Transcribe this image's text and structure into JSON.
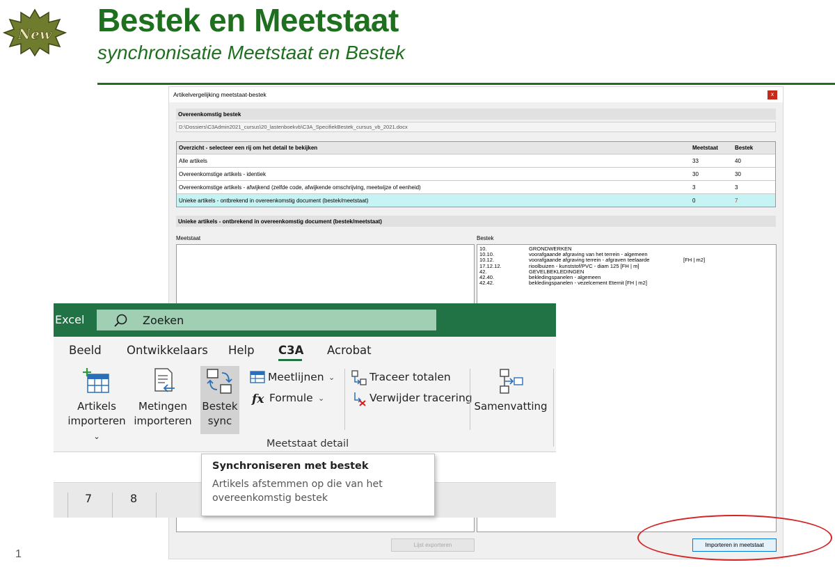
{
  "slide": {
    "title": "Bestek en Meetstaat",
    "subtitle": "synchronisatie Meetstaat en Bestek",
    "badge": "New",
    "page_number": "1"
  },
  "dialog": {
    "title": "Artikelvergelijking meetstaat-bestek",
    "close": "x",
    "section_bestek": "Overeenkomstig bestek",
    "path": "D:\\Dossiers\\C3Admin2021_cursus\\20_lastenboekvb\\C3A_SpecifiekBestek_cursus_vb_2021.docx",
    "overview": {
      "headers": [
        "Overzicht - selecteer een rij om het detail te bekijken",
        "Meetstaat",
        "Bestek"
      ],
      "rows": [
        {
          "label": "Alle artikels",
          "meetstaat": "33",
          "bestek": "40"
        },
        {
          "label": "Overeenkomstige artikels - identiek",
          "meetstaat": "30",
          "bestek": "30"
        },
        {
          "label": "Overeenkomstige artikels - afwijkend (zelfde code, afwijkende omschrijving, meetwijze of eenheid)",
          "meetstaat": "3",
          "bestek": "3"
        },
        {
          "label": "Unieke artikels - ontbrekend in overeenkomstig document (bestek/meetstaat)",
          "meetstaat": "0",
          "bestek": "7"
        }
      ],
      "selected_index": 3
    },
    "detail_section": "Unieke artikels - ontbrekend in overeenkomstig document (bestek/meetstaat)",
    "meetstaat_label": "Meetstaat",
    "bestek_label": "Bestek",
    "bestek_items": [
      {
        "code": "10.",
        "desc": "GRONDWERKEN",
        "unit": ""
      },
      {
        "code": "10.10.",
        "desc": "voorafgaande afgraving van het terrein - algemeen",
        "unit": ""
      },
      {
        "code": "10.12.",
        "desc": "voorafgaande afgraving terrein - afgraven teelaarde",
        "unit": "[FH | m2]"
      },
      {
        "code": "17.12.12.",
        "desc": "rioolbuizen - kunststof/PVC - diam 125  [FH | m]",
        "unit": ""
      },
      {
        "code": "42.",
        "desc": "GEVELBEKLEDINGEN",
        "unit": ""
      },
      {
        "code": "42.40.",
        "desc": "bekledingspanelen - algemeen",
        "unit": ""
      },
      {
        "code": "42.42.",
        "desc": "bekledingspanelen - vezelcement Eternit [FH | m2]",
        "unit": ""
      }
    ],
    "btn_export": "Lijst exporteren",
    "btn_import": "Importeren in meetstaat"
  },
  "excel": {
    "app_name": "Excel",
    "search_placeholder": "Zoeken",
    "tabs": [
      "Beeld",
      "Ontwikkelaars",
      "Help",
      "C3A",
      "Acrobat"
    ],
    "active_tab": "C3A",
    "ribbon": {
      "artikels_importeren": [
        "Artikels",
        "importeren"
      ],
      "metingen_importeren": [
        "Metingen",
        "importeren"
      ],
      "bestek_sync": [
        "Bestek",
        "sync"
      ],
      "meetlijnen": "Meetlijnen",
      "formule": "Formule",
      "traceer_totalen": "Traceer totalen",
      "verwijder_tracering": "Verwijder tracering",
      "samenvatting": "Samenvatting",
      "group_label": "Meetstaat detail"
    },
    "column_headers": [
      "7",
      "8"
    ],
    "tooltip": {
      "title": "Synchroniseren met bestek",
      "body_line1": "Artikels afstemmen op die van het",
      "body_line2": "overeenkomstig bestek"
    }
  },
  "colors": {
    "title_green": "#1e6f1e",
    "excel_green": "#217346",
    "highlight_row": "#c6f4f4",
    "annotation_red": "#d42426"
  }
}
